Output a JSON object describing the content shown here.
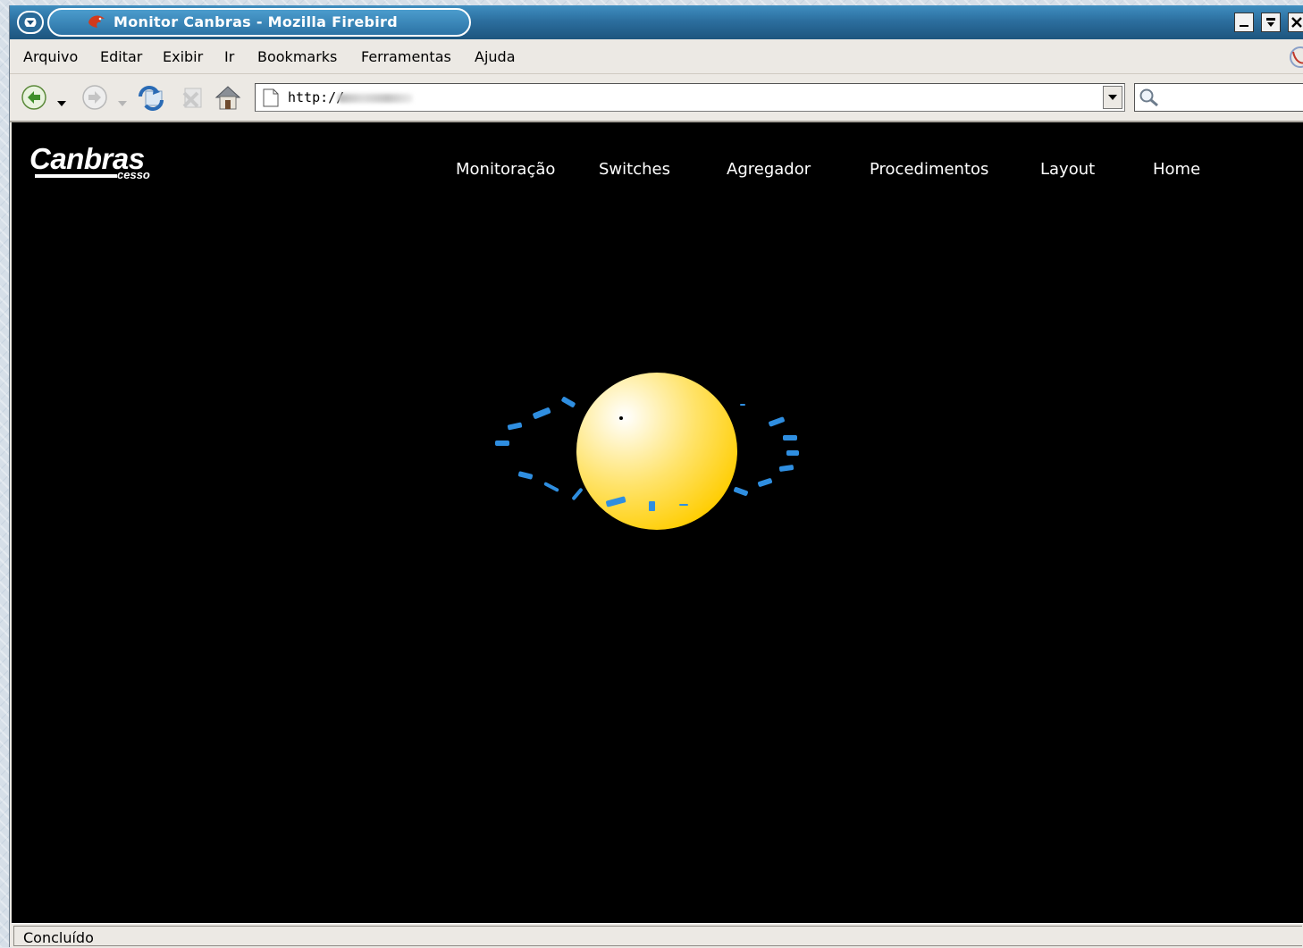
{
  "window": {
    "title": "Monitor Canbras - Mozilla Firebird"
  },
  "menubar": {
    "items": [
      "Arquivo",
      "Editar",
      "Exibir",
      "Ir",
      "Bookmarks",
      "Ferramentas",
      "Ajuda"
    ]
  },
  "navbar": {
    "url": "http://"
  },
  "page": {
    "logo": "Canbras",
    "logo_sub": "cesso",
    "nav": [
      "Monitoração",
      "Switches",
      "Agregador",
      "Procedimentos",
      "Layout",
      "Home"
    ]
  },
  "status": {
    "text": "Concluído"
  },
  "colors": {
    "titlebar": "#2c6f9f",
    "page_background": "#000000",
    "sphere": "#ffd200",
    "ring_text": "#2f8ee0"
  }
}
